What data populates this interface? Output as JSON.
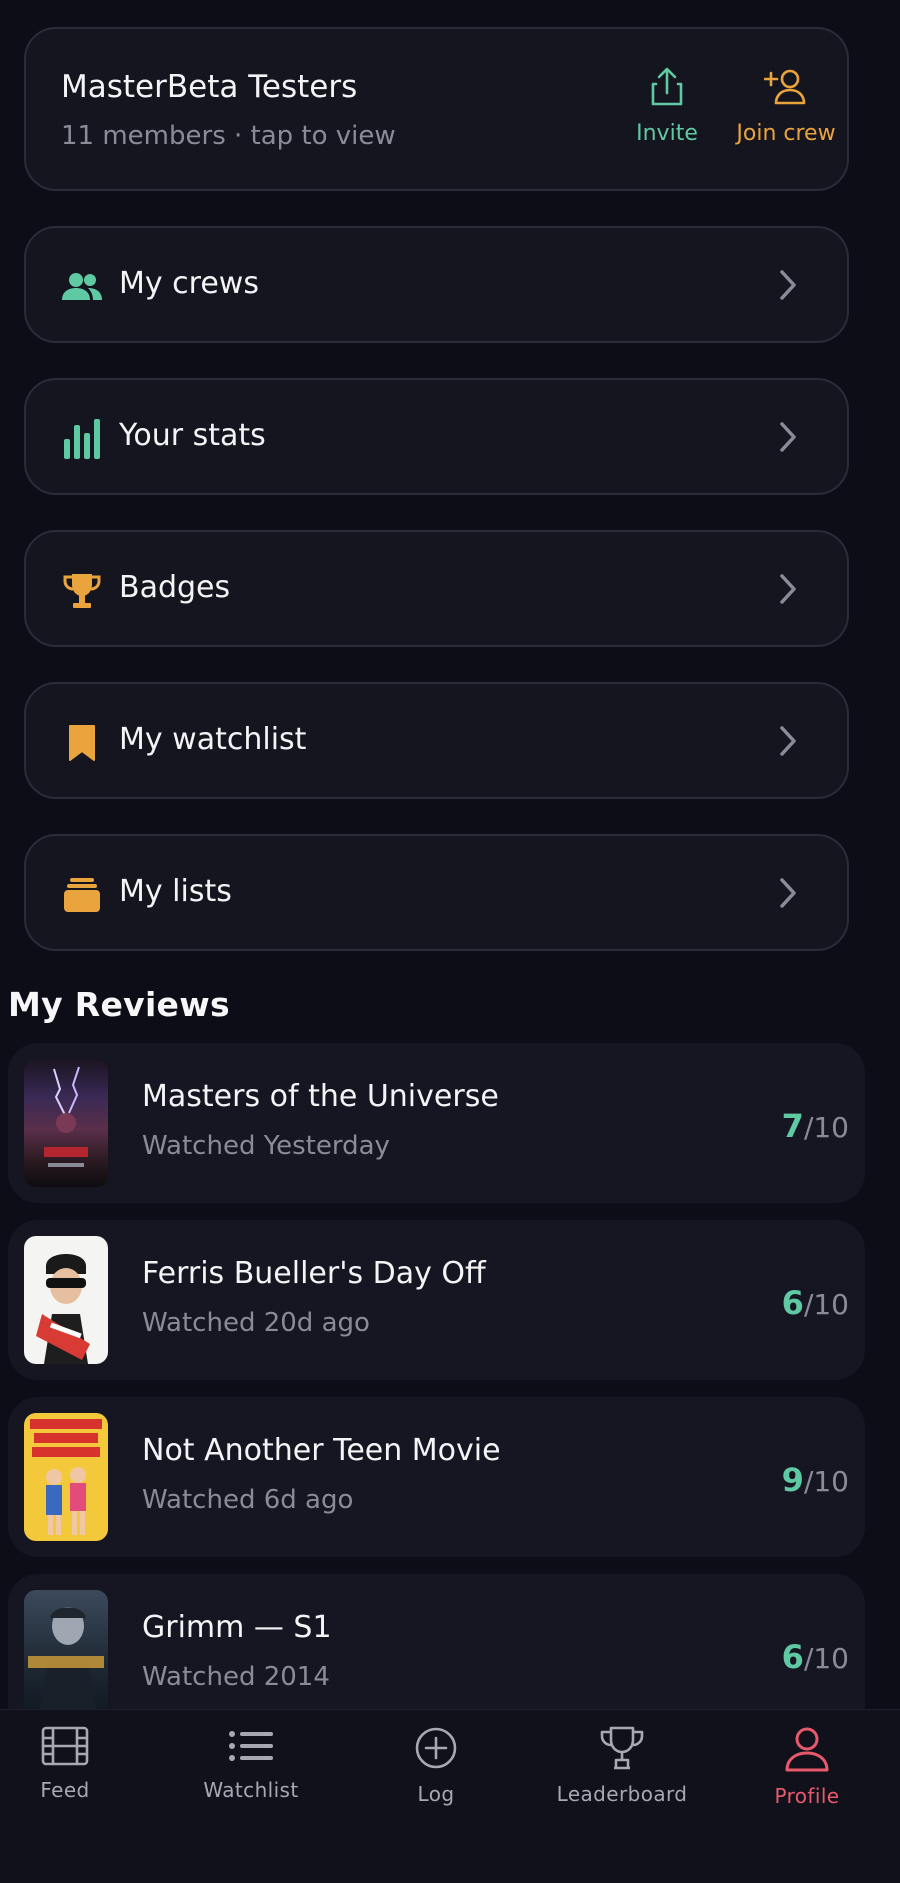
{
  "crew": {
    "name": "MasterBeta Testers",
    "subtitle": "11 members · tap to view",
    "invite_label": "Invite",
    "join_label": "Join crew",
    "invite_color": "#5fc9a3",
    "join_color": "#eaa43e"
  },
  "menu": [
    {
      "label": "My crews",
      "icon": "people-icon",
      "color": "#5fc9a3"
    },
    {
      "label": "Your stats",
      "icon": "bar-chart-icon",
      "color": "#5fc9a3"
    },
    {
      "label": "Badges",
      "icon": "trophy-icon",
      "color": "#eaa43e"
    },
    {
      "label": "My watchlist",
      "icon": "bookmark-icon",
      "color": "#eaa43e"
    },
    {
      "label": "My lists",
      "icon": "stack-icon",
      "color": "#eaa43e"
    }
  ],
  "reviews_section": {
    "title": "My Reviews",
    "items": [
      {
        "title": "Masters of the Universe",
        "watched": "Watched Yesterday",
        "score": "7",
        "max": "/10"
      },
      {
        "title": "Ferris Bueller's Day Off",
        "watched": "Watched 20d ago",
        "score": "6",
        "max": "/10"
      },
      {
        "title": "Not Another Teen Movie",
        "watched": "Watched 6d ago",
        "score": "9",
        "max": "/10"
      },
      {
        "title": "Grimm — S1",
        "watched": "Watched 2014",
        "score": "6",
        "max": "/10"
      }
    ]
  },
  "tabbar": {
    "tabs": [
      {
        "label": "Feed",
        "icon": "film-icon"
      },
      {
        "label": "Watchlist",
        "icon": "list-icon"
      },
      {
        "label": "Log",
        "icon": "plus-circle-icon"
      },
      {
        "label": "Leaderboard",
        "icon": "trophy-outline-icon"
      },
      {
        "label": "Profile",
        "icon": "person-icon",
        "active": true
      }
    ],
    "active_color": "#e9596c"
  }
}
